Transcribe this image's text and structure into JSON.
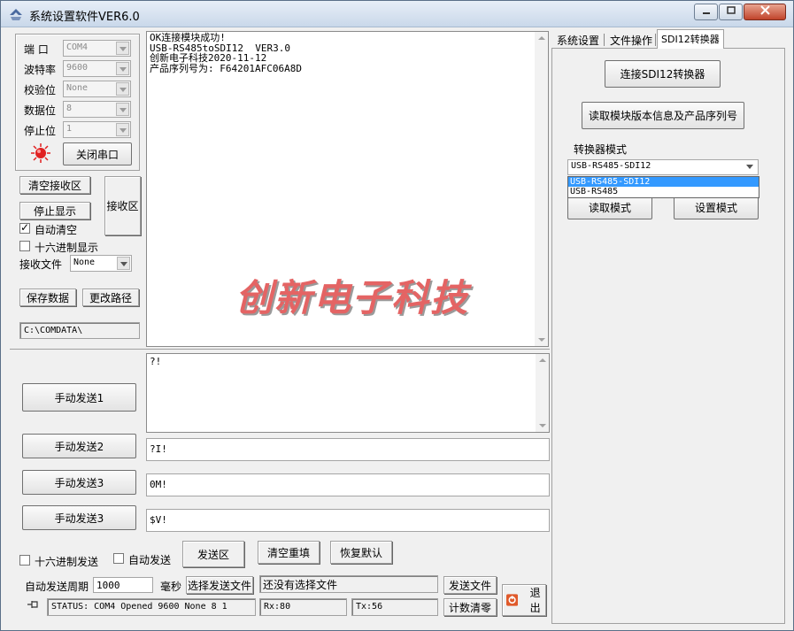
{
  "window": {
    "title": "系统设置软件VER6.0",
    "controls": [
      "▁",
      "□",
      "✕"
    ]
  },
  "serial": {
    "port_label": "端  口",
    "port_value": "COM4",
    "baud_label": "波特率",
    "baud_value": "9600",
    "parity_label": "校验位",
    "parity_value": "None",
    "databits_label": "数据位",
    "databits_value": "8",
    "stopbits_label": "停止位",
    "stopbits_value": "1",
    "close_port_button": "关闭串口"
  },
  "receive": {
    "clear_button": "清空接收区",
    "stop_display_button": "停止显示",
    "area_button": "接收区",
    "auto_clear_label": "自动清空",
    "auto_clear_checked": true,
    "hex_display_label": "十六进制显示",
    "hex_display_checked": false,
    "file_label": "接收文件",
    "file_value": "None",
    "save_button": "保存数据",
    "change_path_button": "更改路径",
    "path_value": "C:\\COMDATA\\",
    "lines": [
      "OK连接模块成功!",
      "USB-RS485toSDI12  VER3.0",
      "创新电子科技2020-11-12",
      "产品序列号为: F64201AFC06A8D"
    ],
    "watermark": "创新电子科技"
  },
  "send": {
    "rows": [
      {
        "button": "手动发送1",
        "value": "?!"
      },
      {
        "button": "手动发送2",
        "value": "?I!"
      },
      {
        "button": "手动发送3",
        "value": "0M!"
      },
      {
        "button": "手动发送3",
        "value": "$V!"
      }
    ]
  },
  "bottom": {
    "hex_send_label": "十六进制发送",
    "hex_send_checked": false,
    "auto_send_label": "自动发送",
    "auto_send_checked": false,
    "send_area_button": "发送区",
    "clear_reset_button": "清空重填",
    "restore_default_button": "恢复默认",
    "auto_period_label": "自动发送周期",
    "auto_period_value": "1000",
    "ms_label": "毫秒",
    "choose_file_button": "选择发送文件",
    "file_status": "还没有选择文件",
    "send_file_button": "发送文件",
    "status_text": "STATUS: COM4 Opened 9600 None 8 1",
    "rx_text": "Rx:80",
    "tx_text": "Tx:56",
    "reset_count_button": "计数清零",
    "exit_button": "退出"
  },
  "right_panel": {
    "tabs": [
      "系统设置",
      "文件操作",
      "SDI12转换器"
    ],
    "active_tab": 2,
    "connect_button": "连接SDI12转换器",
    "read_info_button": "读取模块版本信息及产品序列号",
    "mode_label": "转换器模式",
    "mode_value": "USB-RS485-SDI12",
    "mode_options": [
      "USB-RS485-SDI12",
      "USB-RS485"
    ],
    "read_mode_button": "读取模式",
    "set_mode_button": "设置模式"
  },
  "colors": {
    "window_bg": "#f0f0f0",
    "watermark": "#e46464",
    "selection": "#3399ff",
    "led": "#e02020"
  }
}
